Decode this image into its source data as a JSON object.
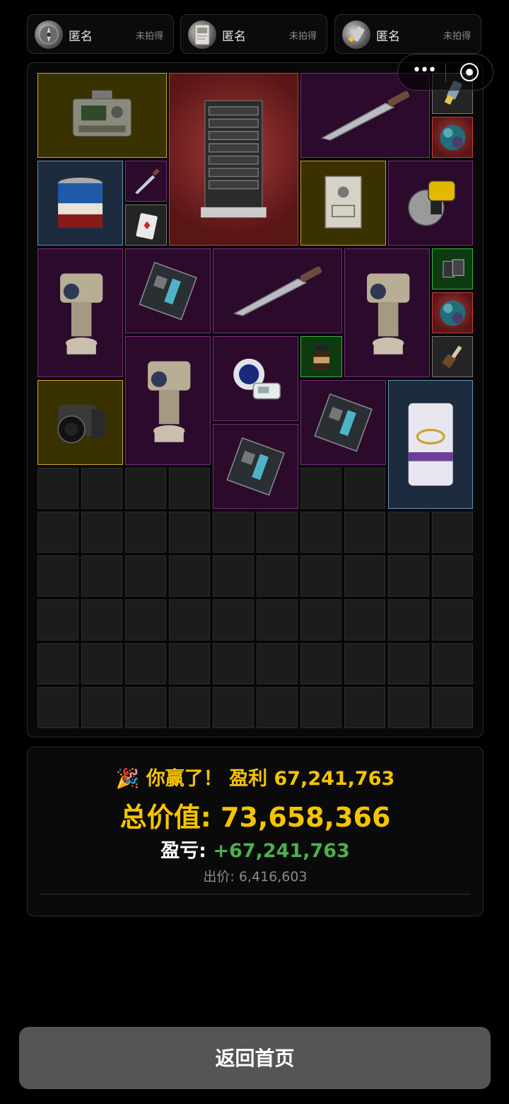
{
  "bidders": [
    {
      "name": "匿名",
      "status": "未拍得",
      "icon": "compass-avatar-icon"
    },
    {
      "name": "匿名",
      "status": "未拍得",
      "icon": "card-avatar-icon"
    },
    {
      "name": "匿名",
      "status": "未拍得",
      "icon": "usb-drive-avatar-icon"
    }
  ],
  "items": [
    {
      "name": "military-radio",
      "rarity": "yellow"
    },
    {
      "name": "server-rack",
      "rarity": "red"
    },
    {
      "name": "combat-knife",
      "rarity": "purple"
    },
    {
      "name": "usb-drive",
      "rarity": "gray"
    },
    {
      "name": "glass-orb",
      "rarity": "red"
    },
    {
      "name": "paint-bucket",
      "rarity": "blue"
    },
    {
      "name": "small-knife",
      "rarity": "purple"
    },
    {
      "name": "playing-card",
      "rarity": "gray"
    },
    {
      "name": "clipboard-document",
      "rarity": "yellow"
    },
    {
      "name": "circular-saw",
      "rarity": "purple"
    },
    {
      "name": "security-camera",
      "rarity": "purple"
    },
    {
      "name": "motherboard",
      "rarity": "purple"
    },
    {
      "name": "combat-knife",
      "rarity": "purple"
    },
    {
      "name": "security-camera",
      "rarity": "purple"
    },
    {
      "name": "ssd-chips",
      "rarity": "green"
    },
    {
      "name": "glass-orb",
      "rarity": "red"
    },
    {
      "name": "coffee-jar",
      "rarity": "green"
    },
    {
      "name": "paint-brush",
      "rarity": "gray"
    },
    {
      "name": "security-camera",
      "rarity": "purple"
    },
    {
      "name": "blood-pressure-monitor",
      "rarity": "purple"
    },
    {
      "name": "camera",
      "rarity": "yellow"
    },
    {
      "name": "motherboard",
      "rarity": "purple"
    },
    {
      "name": "motherboard",
      "rarity": "purple"
    },
    {
      "name": "cement-bag",
      "rarity": "blue"
    }
  ],
  "result": {
    "win_text": "🎉 你赢了！ 盈利 67,241,763",
    "total_label": "总价值: 73,658,366",
    "pl_label": "盈亏:",
    "pl_value": "+67,241,763",
    "bid_text": "出价: 6,416,603"
  },
  "home_button": "返回首页",
  "colors": {
    "gold": "#f5c400",
    "profit_green": "#4caf50",
    "rarity_yellow": "#cfa42a",
    "rarity_purple": "#7d2a7e",
    "rarity_red": "#c04040",
    "rarity_blue": "#6d8fb3",
    "rarity_green": "#35b23a"
  }
}
